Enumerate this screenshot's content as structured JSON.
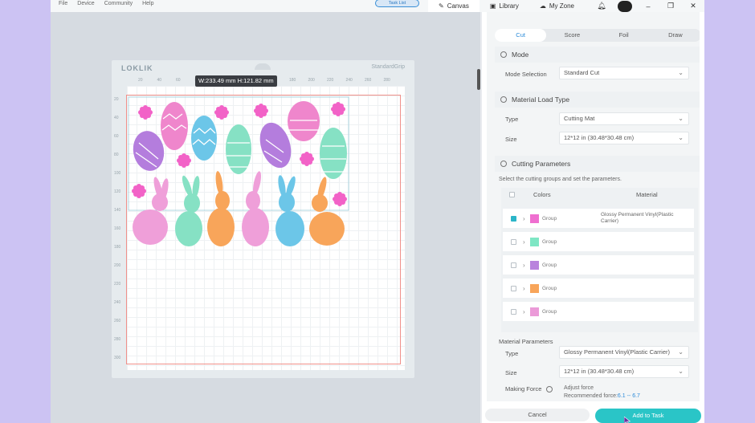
{
  "menu": [
    "File",
    "Device",
    "Community",
    "Help"
  ],
  "task_list_label": "Task List",
  "nav_tabs": [
    {
      "label": "Canvas",
      "icon": "canvas-icon",
      "active": true
    },
    {
      "label": "Library",
      "icon": "library-icon",
      "active": false
    },
    {
      "label": "My Zone",
      "icon": "my-zone-icon",
      "active": false
    }
  ],
  "window_controls": [
    "bell-icon",
    "minimize-icon",
    "restore-icon",
    "close-icon"
  ],
  "mat": {
    "logo": "LOKLIK",
    "brand": "StandardGrip",
    "ruler_top": [
      "20",
      "40",
      "60",
      "80",
      "100",
      "120",
      "140",
      "160",
      "180",
      "200",
      "220",
      "240",
      "260",
      "280"
    ],
    "ruler_left": [
      "20",
      "40",
      "60",
      "80",
      "100",
      "120",
      "140",
      "160",
      "180",
      "200",
      "220",
      "240",
      "260",
      "280",
      "300"
    ],
    "dimensions": "W:233.49 mm  H:121.82 mm"
  },
  "panel": {
    "tabs": [
      "Cut",
      "Score",
      "Foil",
      "Draw"
    ],
    "active_tab": "Cut",
    "mode": {
      "title": "Mode",
      "selection_label": "Mode Selection",
      "selection_value": "Standard Cut"
    },
    "material_load": {
      "title": "Material Load Type",
      "type_label": "Type",
      "type_value": "Cutting Mat",
      "size_label": "Size",
      "size_value": "12*12 in (30.48*30.48 cm)"
    },
    "cutting": {
      "title": "Cutting Parameters",
      "helper": "Select the cutting groups and set the parameters.",
      "col_colors": "Colors",
      "col_material": "Material",
      "rows": [
        {
          "color": "#ef6fd0",
          "label": "Group",
          "material": "Glossy Permanent Vinyl(Plastic Carrier)",
          "checked": true
        },
        {
          "color": "#7ee6c4",
          "label": "Group",
          "material": "",
          "checked": false
        },
        {
          "color": "#b983dd",
          "label": "Group",
          "material": "",
          "checked": false
        },
        {
          "color": "#f8a55a",
          "label": "Group",
          "material": "",
          "checked": false
        },
        {
          "color": "#eb9ad8",
          "label": "Group",
          "material": "",
          "checked": false
        }
      ]
    },
    "material_params": {
      "title": "Material Parameters",
      "type_label": "Type",
      "type_value": "Glossy Permanent Vinyl(Plastic Carrier)",
      "size_label": "Size",
      "size_value": "12*12 in (30.48*30.48 cm)",
      "force_label": "Making Force",
      "adjust_label": "Adjust force",
      "recommended_label": "Recommended force:",
      "recommended_range": "6.1 -- 6.7"
    },
    "cancel_label": "Cancel",
    "add_label": "Add to Task"
  },
  "colors": {
    "accent": "#2c8bd9",
    "add_button": "#2ac5c7",
    "cut_border": "#f0908a",
    "background": "#ccc3f3"
  }
}
